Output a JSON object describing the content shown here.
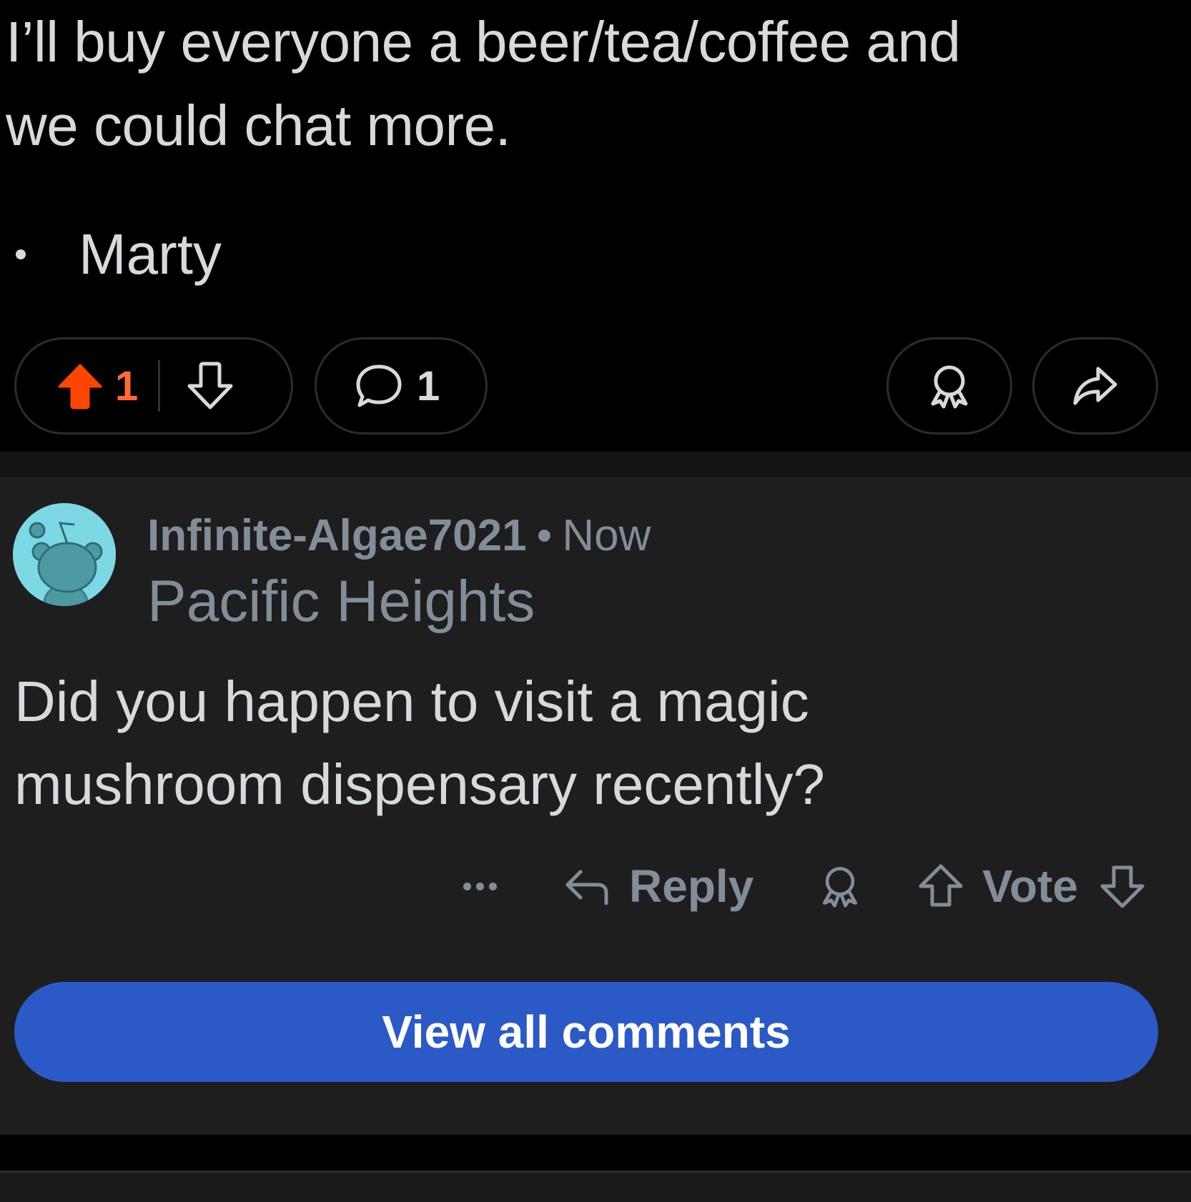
{
  "post": {
    "body_lines": [
      "I’ll buy everyone a beer/tea/coffee and",
      "we could chat more."
    ],
    "signoff": "Marty"
  },
  "action_bar": {
    "upvote_count": "1",
    "comment_count": "1"
  },
  "comment": {
    "username": "Infinite-Algae7021",
    "separator": "•",
    "timestamp": "Now",
    "flair": "Pacific Heights",
    "text_lines": [
      "Did you happen to visit a magic",
      "mushroom dispensary recently?"
    ],
    "reply_label": "Reply",
    "vote_label": "Vote"
  },
  "view_all_label": "View all comments",
  "icons": {
    "upvote": "upvote-arrow-icon",
    "downvote": "downvote-arrow-icon",
    "comment": "speech-bubble-icon",
    "award": "award-ribbon-icon",
    "share": "share-arrow-icon",
    "reply": "reply-arrow-icon",
    "more": "ellipsis-icon"
  },
  "colors": {
    "background": "#000000",
    "comment_card": "#1E1E1E",
    "upvote_active": "#FF4500",
    "upvote_count": "#FF6A33",
    "muted_text": "#818D97",
    "primary_button": "#2B5AC6",
    "avatar_bg": "#7DD8E6"
  }
}
